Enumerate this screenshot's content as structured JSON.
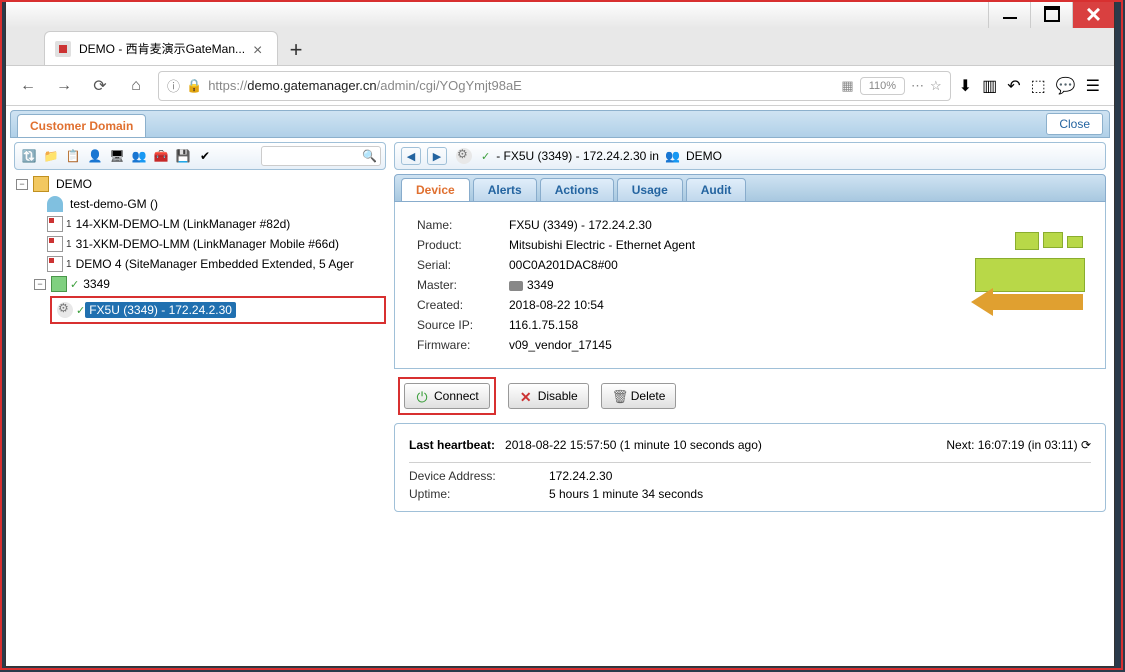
{
  "browser": {
    "tab_title": "DEMO - 西肯麦演示GateMan...",
    "url_display": "https://demo.gatemanager.cn/admin/cgi/YOgYmjt98aE",
    "url_prefix": "https://",
    "url_host": "demo.gatemanager.cn",
    "url_path": "/admin/cgi/YOgYmjt98aE",
    "zoom": "110%"
  },
  "header": {
    "domain_tab": "Customer Domain",
    "close": "Close"
  },
  "tree": {
    "root": "DEMO",
    "items": [
      "test-demo-GM ()",
      "14-XKM-DEMO-LM (LinkManager #82d)",
      "31-XKM-DEMO-LMM (LinkManager Mobile #66d)",
      "DEMO 4 (SiteManager Embedded Extended, 5 Ager"
    ],
    "sub_parent": "3349",
    "selected": "FX5U (3349) - 172.24.2.30"
  },
  "breadcrumb": {
    "device": "- FX5U (3349) - 172.24.2.30 in",
    "domain": "DEMO"
  },
  "tabs": {
    "device": "Device",
    "alerts": "Alerts",
    "actions": "Actions",
    "usage": "Usage",
    "audit": "Audit"
  },
  "device": {
    "name_label": "Name:",
    "name": "FX5U (3349) - 172.24.2.30",
    "product_label": "Product:",
    "product": "Mitsubishi Electric - Ethernet Agent",
    "serial_label": "Serial:",
    "serial": "00C0A201DAC8#00",
    "master_label": "Master:",
    "master": "3349",
    "created_label": "Created:",
    "created": "2018-08-22 10:54",
    "sourceip_label": "Source IP:",
    "sourceip": "116.1.75.158",
    "firmware_label": "Firmware:",
    "firmware": "v09_vendor_17145"
  },
  "buttons": {
    "connect": "Connect",
    "disable": "Disable",
    "delete": "Delete"
  },
  "heartbeat": {
    "label": "Last heartbeat:",
    "value": "2018-08-22 15:57:50 (1 minute 10 seconds ago)",
    "next_label": "Next: 16:07:19 (in 03:11)",
    "addr_label": "Device Address:",
    "addr": "172.24.2.30",
    "uptime_label": "Uptime:",
    "uptime": "5 hours 1 minute 34 seconds"
  }
}
